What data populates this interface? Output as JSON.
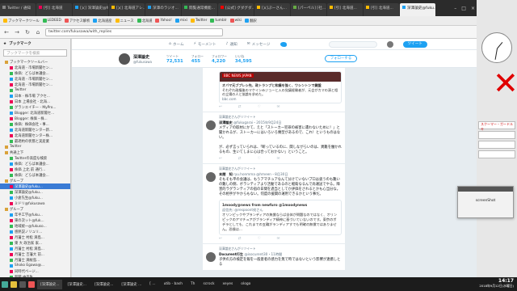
{
  "browser": {
    "tabs": [
      "Twitter / 通知",
      "[引] 北海道",
      "[乂] 深澤論史@fuku...",
      "[乂] 北海道アレ...",
      "深澤のラジオ...",
      "閲覧通常機能...",
      "[公式] グダグダ...",
      "[乂]ぷーさん...",
      "[パーペル] [社...",
      "[引] 北海道...",
      "[引] 北海道...",
      "深澤論史@fuku..."
    ],
    "bookmarks": [
      "ブックマークツール",
      "LEDEED",
      "アクセス解析",
      "北海道産",
      "ニュース",
      "北海道",
      "Yahoo!",
      "mixi",
      "Twitter",
      "tumblr",
      "wiki",
      "翻訳"
    ],
    "url": "twitter.com/fukusawa/with_replies"
  },
  "sidebar": {
    "title": "ブックマーク",
    "search_placeholder": "ブックマークを検索",
    "items": [
      {
        "label": "ブックマークツールバー",
        "folder": true
      },
      {
        "label": "北海道 - 市場新聞セン...",
        "folder": false
      },
      {
        "label": "株価：どらば本議会...",
        "folder": false
      },
      {
        "label": "北海道 - 市場新聞セン...",
        "folder": false
      },
      {
        "label": "北海道 - 市場新聞セン...",
        "folder": false
      },
      {
        "label": "Twitter",
        "folder": false
      },
      {
        "label": "日本 - 株市場 アクセ...",
        "folder": false
      },
      {
        "label": "日本 上場会社 - 北海...",
        "folder": false
      },
      {
        "label": "グランエイチー - MyPro...",
        "folder": false
      },
      {
        "label": "Blogger: 北海道新聞セ...",
        "folder": false
      },
      {
        "label": "Blogger: 株価・株...",
        "folder": false
      },
      {
        "label": "株価：株価会社・事...",
        "folder": false
      },
      {
        "label": "北海道新聞センター新...",
        "folder": false
      },
      {
        "label": "北海道新聞センター株...",
        "folder": false
      },
      {
        "label": "最適約の状態と実産業",
        "folder": false
      },
      {
        "label": "Twitter",
        "folder": true
      },
      {
        "label": "共通上下",
        "folder": true
      },
      {
        "label": "Twitterの高度な検索",
        "folder": false
      },
      {
        "label": "株価：どらば本議会...",
        "folder": false
      },
      {
        "label": "株価 上北 前 通行...",
        "folder": false
      },
      {
        "label": "株価：どらば本議会...",
        "folder": false
      },
      {
        "label": "グループ",
        "folder": true
      },
      {
        "label": "深澤論史@fuku...",
        "folder": false,
        "selected": true
      },
      {
        "label": "深澤論史@fuku...",
        "folder": false
      },
      {
        "label": "小倉先生@fuku...",
        "folder": false
      },
      {
        "label": "ミドリ@fukusawa",
        "folder": false
      },
      {
        "label": "グループ",
        "folder": true
      },
      {
        "label": "年半工学@fuku...",
        "folder": false
      },
      {
        "label": "東の次ット@fuk...",
        "folder": false
      },
      {
        "label": "地域統一@fukuso...",
        "folder": false
      },
      {
        "label": "感熱説ノリュリ...",
        "folder": false
      },
      {
        "label": "月藩士 村松 滴島...",
        "folder": false
      },
      {
        "label": "東 大 政治家 家...",
        "folder": false
      },
      {
        "label": "月藩士 村松 滴島...",
        "folder": false
      },
      {
        "label": "月藩士 吉藩大 前...",
        "folder": false
      },
      {
        "label": "月藩士 滴紋島...",
        "folder": false
      },
      {
        "label": "Shoko Egawa@...",
        "folder": false
      },
      {
        "label": "同時代ページ...",
        "folder": false
      },
      {
        "label": "新聞 中高生...",
        "folder": false
      },
      {
        "label": "年半工学@fuku...",
        "folder": false
      }
    ]
  },
  "twitter": {
    "nav": [
      "ホーム",
      "モーメント",
      "通知",
      "メッセージ"
    ],
    "profile": {
      "name": "深澤論史",
      "handle": "@fukusawa",
      "stats": [
        {
          "label": "ツイート",
          "value": "72,531"
        },
        {
          "label": "フォロー",
          "value": "455"
        },
        {
          "label": "フォロワー",
          "value": "4,220"
        },
        {
          "label": "いいね",
          "value": "34,595"
        }
      ],
      "follow_label": "フォローする",
      "tweet_btn": "ツイート"
    },
    "tweets": [
      {
        "context": "",
        "author": "",
        "handle": "",
        "body": "",
        "card": {
          "badge": "BBC NEWS JAPAN",
          "title": "オバマ元ブプレシ先、政トランプと和議を強く、ワシントンで鍵盤",
          "desc": "それぞれ政権後のマケインみジョーと入の党議経験者が、元会がカマの演と相の立場の人と協論を求めた。",
          "url": "bbc.com"
        }
      },
      {
        "context": "深澤論史さんがリツイート",
        "author": "深澤論史",
        "handle": "@fukugarai・2015年9月24日",
        "body": "メディアの取材にかて、えと「ストーカー犯罪の被害に遭わないために！」と聞かれるが、ストーカーにはいろいろ類型があるので、これ！というものはない。\n\nが、必ず言っていられは、「断っているのに、関しながらいのは、異難を働かれるもの、生いてしまに心は合っておかない」ということ。"
      },
      {
        "context": "深澤論史さんがリツイート",
        "author": "本間　知",
        "handle": "ryu.honmma @hmeen・8月30日",
        "body": "そもそも平の会議は、もうアマチュアなんて分けていないプロは扱うのも難いの難しの側、ボランティアより活動であるのと軽衛なるんで尚運送でやる。障害的ラグランティアの宿の日間を過当としてか評価をされるとかも心当分な。その相手がやからもない。何度の援関の運用できるかという事だ。",
        "quote": {
          "author": "1moody@news from newfuro @1moodynews",
          "sub": "返信先: @respoont宛さん",
          "body": "オリンピックやプランディアの無償ならば自体が問題なのではなく、オリンピックのアマチュアがブランディア精神に基づいていないのです。東京のボデラとしても、これまでの五輪がランディアすでも明確の無償ではありません。恐操は..."
        }
      },
      {
        "context": "深澤論史さんがリツイート",
        "author": "Docurent行生",
        "handle": "@isocurent30・11時間",
        "body": "子供の方の検定を報を一般意者の感力を無で時ではないという影響が連携しとる"
      }
    ]
  },
  "desktop": {
    "popup_text": "screenShot",
    "mini_panels": [
      "スクーマー・ガードルキ",
      "",
      "",
      ""
    ]
  },
  "taskbar": {
    "items": [
      "[深澤論史...",
      "[深澤論史...",
      "[深澤論史...",
      "[深澤論史 ...",
      "[ ...",
      "utib - bash",
      "Th",
      "scrock",
      "xeyes",
      "ologo"
    ],
    "time": "14:17",
    "date": "2018年9月12日(水曜日)"
  },
  "colors": {
    "twitter_blue": "#1da1f2",
    "sidebar_selected": "#3a7bd5",
    "bbc_red": "#b80000",
    "close_x": "#e00000"
  }
}
